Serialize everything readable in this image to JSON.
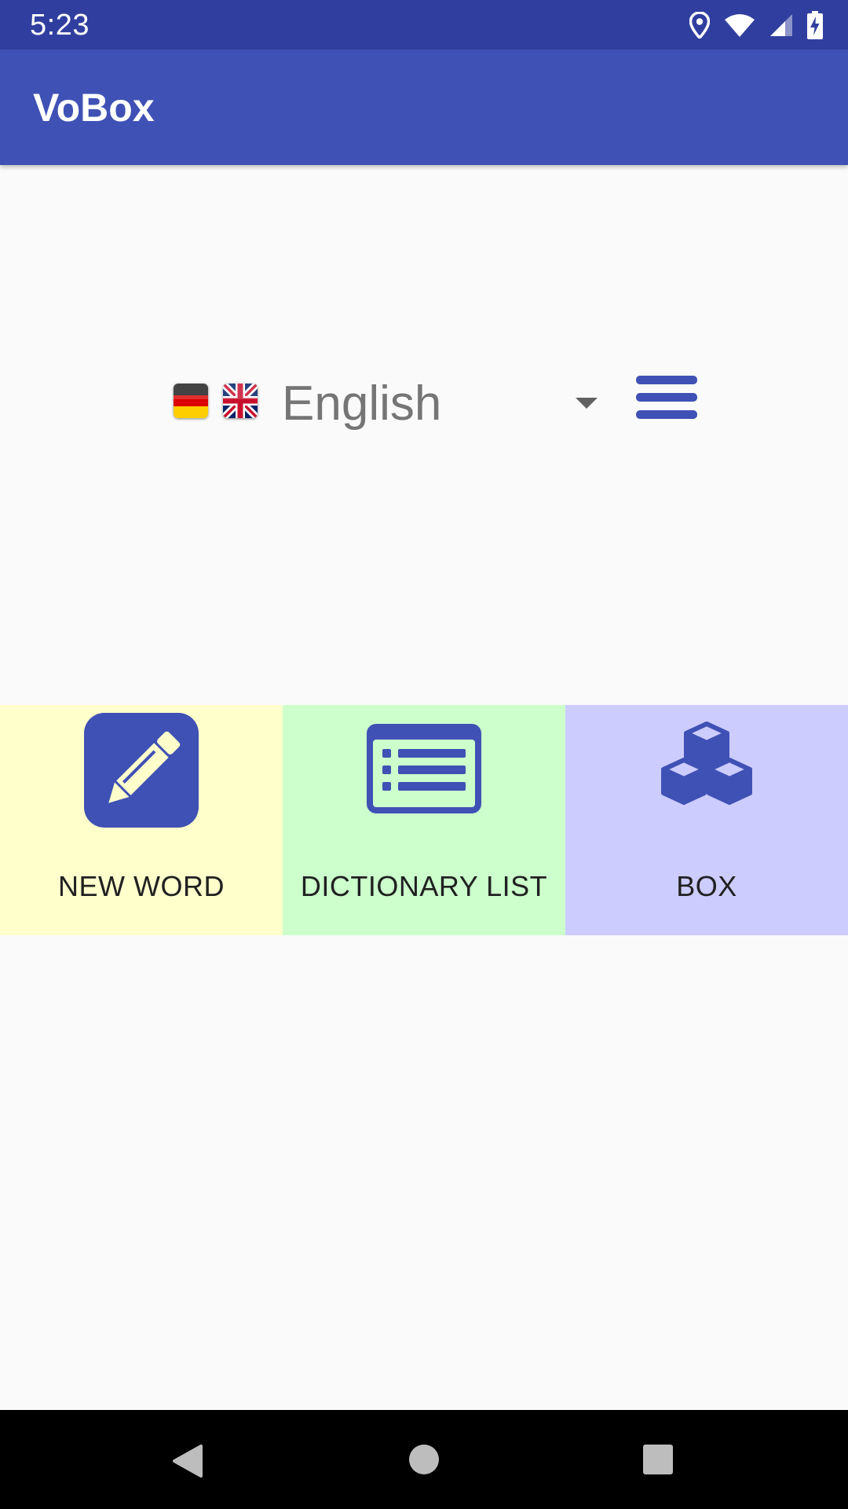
{
  "status_bar": {
    "time": "5:23",
    "icons": [
      "location-icon",
      "wifi-icon",
      "signal-icon",
      "battery-charging-icon"
    ]
  },
  "app_bar": {
    "title": "VoBox",
    "color": "#3f51b5"
  },
  "language": {
    "source_flag": "germany-flag-icon",
    "target_flag": "united-kingdom-flag-icon",
    "selected": "English",
    "menu_icon": "hamburger-menu-icon"
  },
  "tiles": [
    {
      "label": "NEW WORD",
      "icon": "pencil-icon",
      "background": "#ffffcc"
    },
    {
      "label": "DICTIONARY LIST",
      "icon": "list-icon",
      "background": "#ccffcc"
    },
    {
      "label": "BOX",
      "icon": "cubes-icon",
      "background": "#ccccff"
    }
  ],
  "nav_bar": {
    "buttons": [
      "back-icon",
      "home-icon",
      "recents-icon"
    ]
  },
  "colors": {
    "primary": "#3f51b5",
    "primary_dark": "#303f9f",
    "background": "#fafafa"
  }
}
